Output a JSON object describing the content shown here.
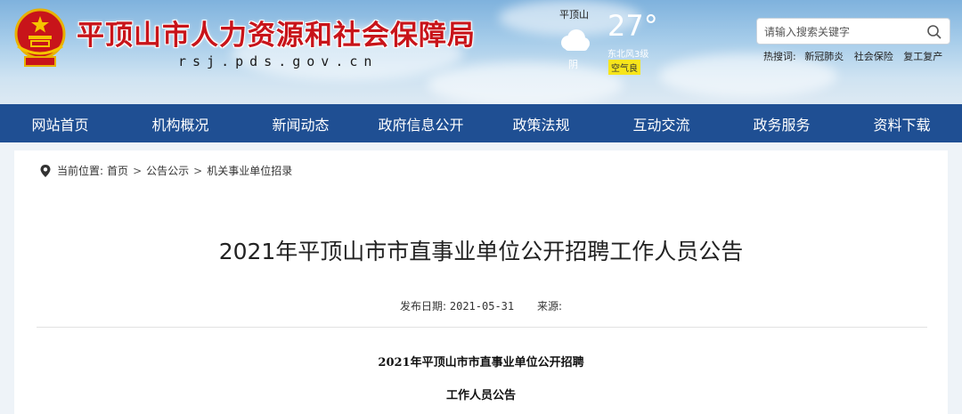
{
  "header": {
    "title": "平顶山市人力资源和社会保障局",
    "domain": "rsj.pds.gov.cn"
  },
  "weather": {
    "city": "平顶山",
    "temperature": "27°",
    "condition": "阴",
    "wind": "东北风3级",
    "air_quality": "空气良"
  },
  "search": {
    "placeholder": "请输入搜索关键字",
    "hot_label": "热搜词:",
    "hot_keywords": [
      "新冠肺炎",
      "社会保险",
      "复工复产"
    ]
  },
  "nav": {
    "items": [
      "网站首页",
      "机构概况",
      "新闻动态",
      "政府信息公开",
      "政策法规",
      "互动交流",
      "政务服务",
      "资料下载"
    ]
  },
  "breadcrumb": {
    "label": "当前位置:",
    "items": [
      "首页",
      "公告公示",
      "机关事业单位招录"
    ]
  },
  "article": {
    "title": "2021年平顶山市市直事业单位公开招聘工作人员公告",
    "date_label": "发布日期:",
    "date": "2021-05-31",
    "source_label": "来源:",
    "body_line1": "2021年平顶山市市直事业单位公开招聘",
    "body_line2": "工作人员公告"
  },
  "colors": {
    "brand_red": "#c8141a",
    "nav_blue": "#1f4f93",
    "aqi_yellow": "#f7e51b"
  }
}
